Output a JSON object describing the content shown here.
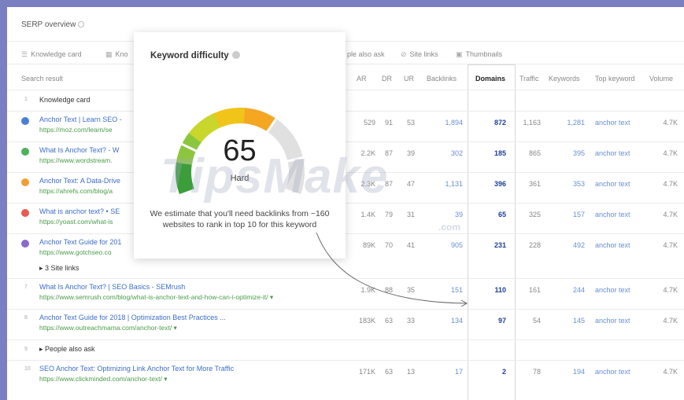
{
  "header": {
    "title": "SERP overview"
  },
  "features": [
    {
      "icon": "list-icon",
      "label": "Knowledge card"
    },
    {
      "icon": "grid-icon",
      "label": "Kno"
    },
    {
      "icon": "",
      "label": "ple also ask"
    },
    {
      "icon": "link-icon",
      "label": "Site links"
    },
    {
      "icon": "image-icon",
      "label": "Thumbnails"
    }
  ],
  "columns": {
    "search_result": "Search result",
    "ar": "AR",
    "dr": "DR",
    "ur": "UR",
    "backlinks": "Backlinks",
    "domains": "Domains",
    "traffic": "Traffic",
    "keywords": "Keywords",
    "top_keyword": "Top keyword",
    "volume": "Volume"
  },
  "rows": [
    {
      "num": "1",
      "label": "Knowledge card"
    },
    {
      "dot_color": "#4a7fd8",
      "title": "Anchor Text | Learn SEO -",
      "url": "https://moz.com/learn/se",
      "ar": "529",
      "dr": "91",
      "ur": "53",
      "backlinks": "1,894",
      "domains": "872",
      "traffic": "1,163",
      "keywords": "1,281",
      "top_keyword": "anchor text",
      "volume": "4.7K"
    },
    {
      "dot_color": "#4bb35a",
      "title": "What Is Anchor Text? - W",
      "url": "https://www.wordstream.",
      "ar": "2.2K",
      "dr": "87",
      "ur": "39",
      "backlinks": "302",
      "domains": "185",
      "traffic": "865",
      "keywords": "395",
      "top_keyword": "anchor text",
      "volume": "4.7K"
    },
    {
      "dot_color": "#f0a033",
      "title": "Anchor Text: A Data-Drive",
      "url": "https://ahrefs.com/blog/a",
      "ar": "2.3K",
      "dr": "87",
      "ur": "47",
      "backlinks": "1,131",
      "domains": "396",
      "traffic": "361",
      "keywords": "353",
      "top_keyword": "anchor text",
      "volume": "4.7K"
    },
    {
      "dot_color": "#e85a4f",
      "title": "What is anchor text? • SE",
      "url": "https://yoast.com/what-is",
      "ar": "1.4K",
      "dr": "79",
      "ur": "31",
      "backlinks": "39",
      "domains": "65",
      "traffic": "325",
      "keywords": "157",
      "top_keyword": "anchor text",
      "volume": "4.7K"
    },
    {
      "dot_color": "#8a6bc9",
      "title": "Anchor Text Guide for 201",
      "url": "https://www.gotchseo.co",
      "ar": "89K",
      "dr": "70",
      "ur": "41",
      "backlinks": "905",
      "domains": "231",
      "traffic": "228",
      "keywords": "492",
      "top_keyword": "anchor text",
      "volume": "4.7K"
    },
    {
      "label": "▸  3 Site links"
    },
    {
      "num": "7",
      "title": "What Is Anchor Text? | SEO Basics - SEMrush",
      "url": "https://www.semrush.com/blog/what-is-anchor-text-and-how-can-i-optimize-it/ ▾",
      "ar": "1.9K",
      "dr": "88",
      "ur": "35",
      "backlinks": "151",
      "domains": "110",
      "traffic": "161",
      "keywords": "244",
      "top_keyword": "anchor text",
      "volume": "4.7K"
    },
    {
      "num": "8",
      "title": "Anchor Text Guide for 2018 | Optimization Best Practices ...",
      "url": "https://www.outreachmama.com/anchor-text/ ▾",
      "ar": "183K",
      "dr": "63",
      "ur": "33",
      "backlinks": "134",
      "domains": "97",
      "traffic": "54",
      "keywords": "145",
      "top_keyword": "anchor text",
      "volume": "4.7K"
    },
    {
      "num": "9",
      "label": "▸  People also ask"
    },
    {
      "num": "10",
      "title": "SEO Anchor Text: Optimizing Link Anchor Text for More Traffic",
      "url": "https://www.clickminded.com/anchor-text/ ▾",
      "ar": "171K",
      "dr": "63",
      "ur": "13",
      "backlinks": "17",
      "domains": "2",
      "traffic": "78",
      "keywords": "194",
      "top_keyword": "anchor text",
      "volume": "4.7K"
    }
  ],
  "popup": {
    "title": "Keyword difficulty",
    "score": "65",
    "score_fraction": 0.65,
    "label": "Hard",
    "description": "We estimate that you'll need backlinks from ~160 websites to rank in top 10 for this keyword",
    "colors": [
      "#3c9e3a",
      "#8cc63f",
      "#c9d62c",
      "#f0c419",
      "#f5a623",
      "#e0e0e0"
    ]
  },
  "watermark": {
    "text": "TipsMake",
    "sub": ".com"
  }
}
